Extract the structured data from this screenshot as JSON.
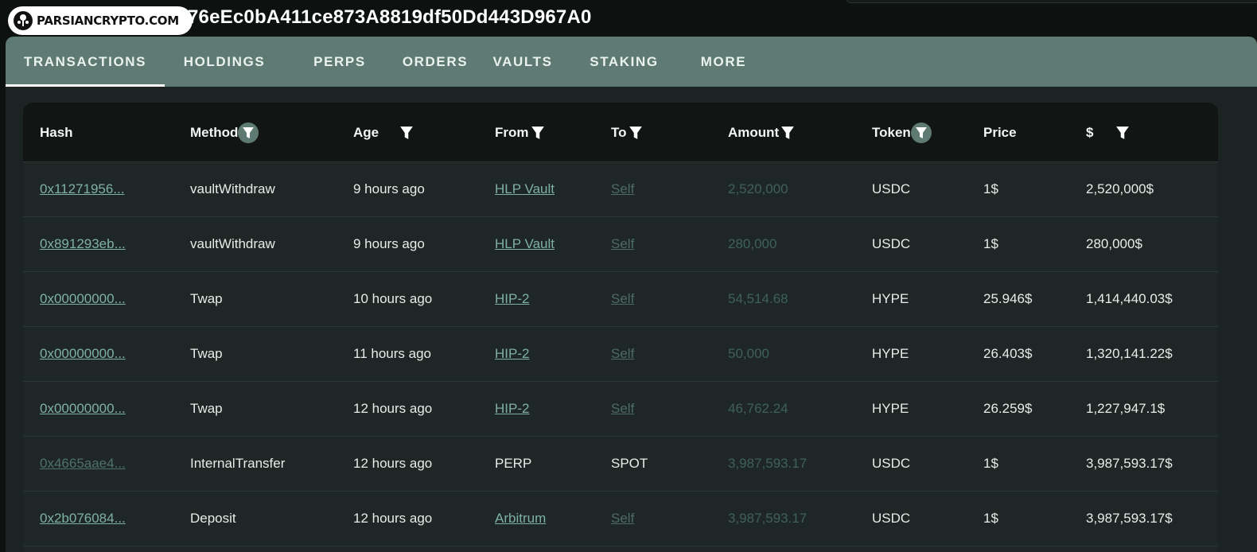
{
  "logo": {
    "text": "PARSIANCRYPTO.COM"
  },
  "address": "76eEc0bA411ce873A8819df50Dd443D967A0",
  "tabs": [
    {
      "label": "TRANSACTIONS",
      "active": true
    },
    {
      "label": "HOLDINGS"
    },
    {
      "label": "PERPS"
    },
    {
      "label": "ORDERS"
    },
    {
      "label": "VAULTS"
    },
    {
      "label": "STAKING"
    },
    {
      "label": "MORE"
    }
  ],
  "table": {
    "headers": {
      "hash": "Hash",
      "method": "Method",
      "age": "Age",
      "from": "From",
      "to": "To",
      "amount": "Amount",
      "token": "Token",
      "price": "Price",
      "usd": "$"
    },
    "rows": [
      {
        "hash": "0x11271956...",
        "method": "vaultWithdraw",
        "age": "9 hours ago",
        "from": "HLP Vault",
        "to": "Self",
        "amount": "2,520,000",
        "token": "USDC",
        "price": "1$",
        "usd": "2,520,000$"
      },
      {
        "hash": "0x891293eb...",
        "method": "vaultWithdraw",
        "age": "9 hours ago",
        "from": "HLP Vault",
        "to": "Self",
        "amount": "280,000",
        "token": "USDC",
        "price": "1$",
        "usd": "280,000$"
      },
      {
        "hash": "0x00000000...",
        "method": "Twap",
        "age": "10 hours ago",
        "from": "HIP-2",
        "to": "Self",
        "amount": "54,514.68",
        "token": "HYPE",
        "price": "25.946$",
        "usd": "1,414,440.03$"
      },
      {
        "hash": "0x00000000...",
        "method": "Twap",
        "age": "11 hours ago",
        "from": "HIP-2",
        "to": "Self",
        "amount": "50,000",
        "token": "HYPE",
        "price": "26.403$",
        "usd": "1,320,141.22$"
      },
      {
        "hash": "0x00000000...",
        "method": "Twap",
        "age": "12 hours ago",
        "from": "HIP-2",
        "to": "Self",
        "amount": "46,762.24",
        "token": "HYPE",
        "price": "26.259$",
        "usd": "1,227,947.1$"
      },
      {
        "hash": "0x4665aae4...",
        "method": "InternalTransfer",
        "age": "12 hours ago",
        "from": "PERP",
        "to": "SPOT",
        "amount": "3,987,593.17",
        "token": "USDC",
        "price": "1$",
        "usd": "3,987,593.17$",
        "plain": true
      },
      {
        "hash": "0x2b076084...",
        "method": "Deposit",
        "age": "12 hours ago",
        "from": "Arbitrum",
        "to": "Self",
        "amount": "3,987,593.17",
        "token": "USDC",
        "price": "1$",
        "usd": "3,987,593.17$"
      }
    ]
  }
}
